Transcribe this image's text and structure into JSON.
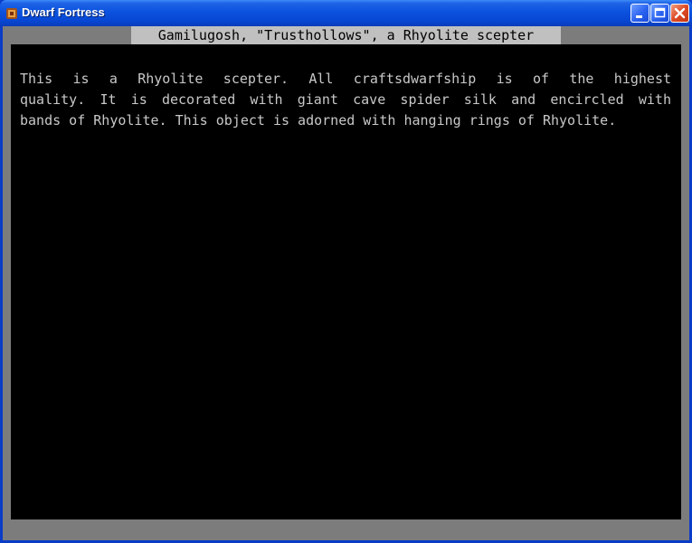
{
  "window": {
    "title": "Dwarf Fortress",
    "icon": "dwarf-fortress-icon"
  },
  "controls": {
    "minimize": "minimize-icon",
    "maximize": "maximize-icon",
    "close": "close-icon"
  },
  "item": {
    "header": "Gamilugosh, \"Trusthollows\", a Rhyolite scepter",
    "lines": [
      "This is a Rhyolite scepter. All craftsdwarfship is of the highest",
      "quality. It is decorated with giant cave spider silk and encircled with",
      "bands of Rhyolite. This object is adorned with hanging rings of Rhyolite."
    ]
  }
}
